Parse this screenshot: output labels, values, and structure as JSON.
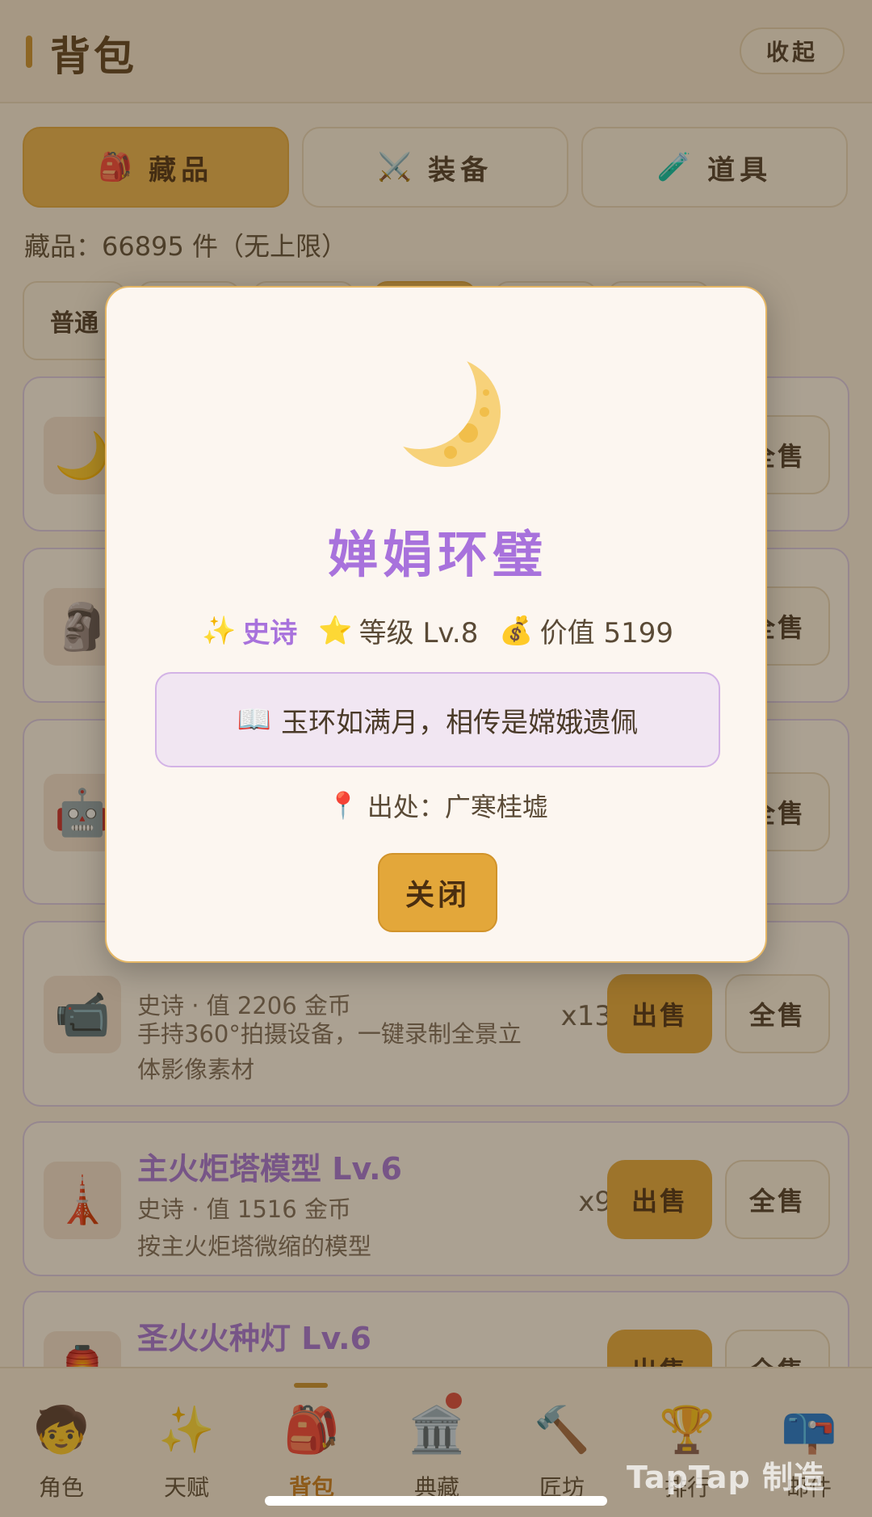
{
  "header": {
    "title": "背包",
    "collapse_label": "收起"
  },
  "tabs": [
    {
      "icon": "🎒",
      "icon_name": "backpack-icon",
      "label": "藏品",
      "active": true
    },
    {
      "icon": "⚔️",
      "icon_name": "crossed-swords-icon",
      "label": "装备",
      "active": false
    },
    {
      "icon": "🧪",
      "icon_name": "test-tube-icon",
      "label": "道具",
      "active": false
    }
  ],
  "collection_count": "藏品：66895 件（无上限）",
  "filters": {
    "first_label": "普通"
  },
  "items": [
    {
      "icon": "🌙",
      "icon_name": "crescent-moon-icon",
      "sell_all": "全售"
    },
    {
      "icon": "🗿",
      "icon_name": "moai-icon",
      "sell_all": "全售"
    },
    {
      "icon": "🤖",
      "icon_name": "robot-icon",
      "sell_all": "全售"
    },
    {
      "icon": "📹",
      "icon_name": "video-camera-icon",
      "meta": "史诗 · 值 2206 金币",
      "desc": "手持360°拍摄设备，一键录制全景立体影像素材",
      "qty": "x13",
      "sell": "出售",
      "sell_all": "全售"
    },
    {
      "icon": "🗼",
      "icon_name": "tower-icon",
      "name": "主火炬塔模型  Lv.6",
      "meta": "史诗 · 值 1516 金币",
      "desc": "按主火炬塔微缩的模型",
      "qty": "x9",
      "sell": "出售",
      "sell_all": "全售"
    },
    {
      "icon": "🏮",
      "icon_name": "lantern-icon",
      "name": "圣火火种灯  Lv.6",
      "sell": "出售",
      "sell_all": "全售"
    }
  ],
  "nav": [
    {
      "icon": "🧒",
      "icon_name": "character-icon",
      "label": "角色"
    },
    {
      "icon": "✨",
      "icon_name": "sparkles-icon",
      "label": "天赋"
    },
    {
      "icon": "🎒",
      "icon_name": "backpack-icon",
      "label": "背包",
      "active": true
    },
    {
      "icon": "🏛️",
      "icon_name": "museum-icon",
      "label": "典藏"
    },
    {
      "icon": "🔨",
      "icon_name": "hammer-icon",
      "label": "匠坊"
    },
    {
      "icon": "🏆",
      "icon_name": "trophy-icon",
      "label": "排行"
    },
    {
      "icon": "📪",
      "icon_name": "mailbox-icon",
      "label": "邮件"
    }
  ],
  "watermark": "TapTap 制造",
  "modal": {
    "icon_name": "crescent-moon-icon",
    "title": "婵娟环璧",
    "rarity_icon": "✨",
    "rarity": "史诗",
    "level_icon": "⭐",
    "level": "等级 Lv.8",
    "value_icon": "💰",
    "value": "价值 5199",
    "quote_icon": "📖",
    "quote": "玉环如满月，相传是嫦娥遗佩",
    "origin_icon": "📍",
    "origin": "出处：广寒桂墟",
    "close_label": "关闭"
  },
  "colors": {
    "accent": "#e3a73a",
    "epic_purple": "#a872dc",
    "background": "#f6ecdd"
  }
}
